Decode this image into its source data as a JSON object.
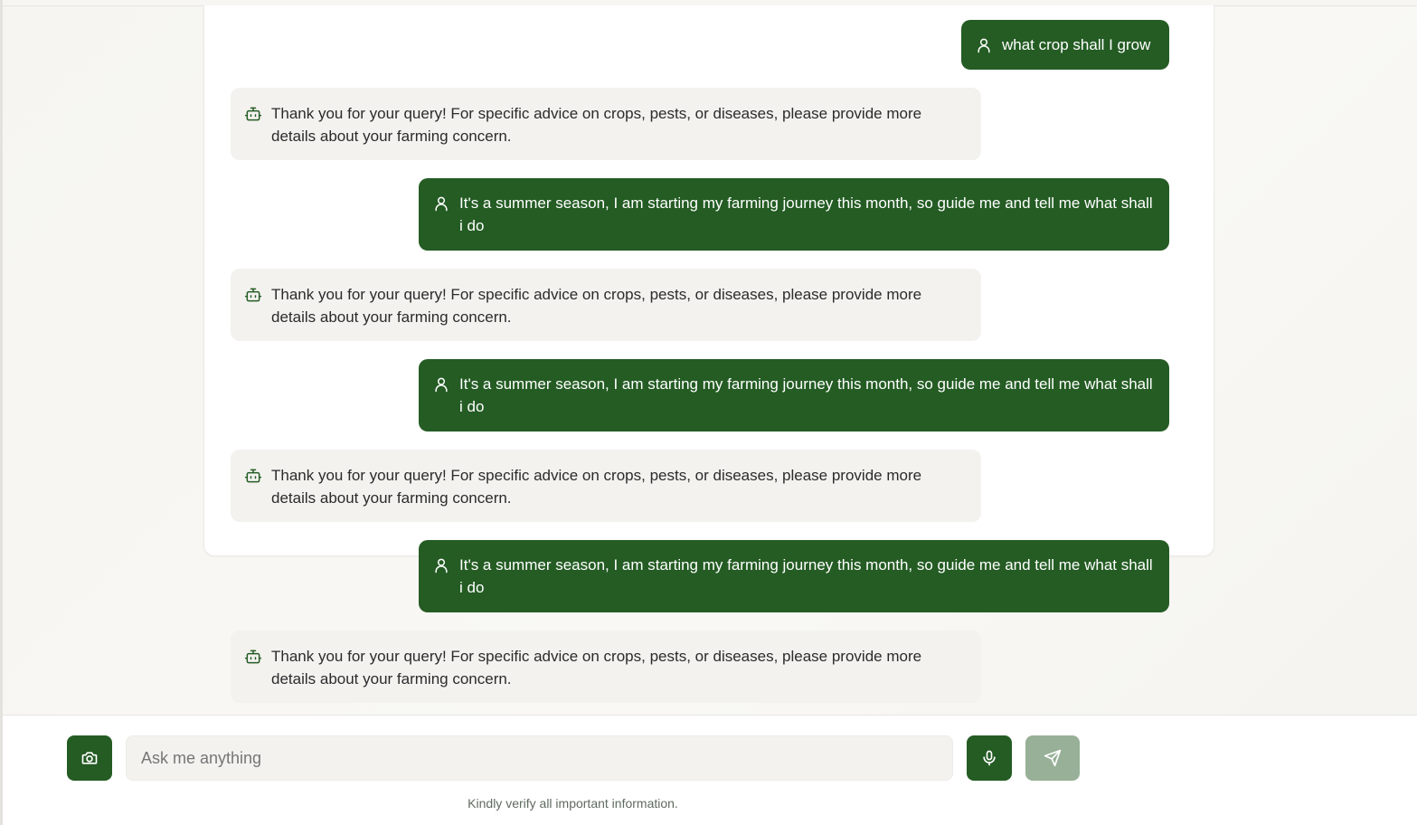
{
  "conversation": {
    "messages": [
      {
        "role": "user",
        "text": "what crop shall I grow"
      },
      {
        "role": "bot",
        "text": "Thank you for your query! For specific advice on crops, pests, or diseases, please provide more details about your farming concern."
      },
      {
        "role": "user",
        "text": "It's a summer season, I am starting my farming journey this month, so guide me and tell me what shall i do"
      },
      {
        "role": "bot",
        "text": "Thank you for your query! For specific advice on crops, pests, or diseases, please provide more details about your farming concern."
      },
      {
        "role": "user",
        "text": "It's a summer season, I am starting my farming journey this month, so guide me and tell me what shall i do"
      },
      {
        "role": "bot",
        "text": "Thank you for your query! For specific advice on crops, pests, or diseases, please provide more details about your farming concern."
      },
      {
        "role": "user",
        "text": "It's a summer season, I am starting my farming journey this month, so guide me and tell me what shall i do"
      },
      {
        "role": "bot",
        "text": "Thank you for your query! For specific advice on crops, pests, or diseases, please provide more details about your farming concern."
      }
    ],
    "icons": {
      "user": "user-icon",
      "bot": "bot-icon"
    }
  },
  "composer": {
    "input_placeholder": "Ask me anything",
    "input_value": "",
    "disclaimer": "Kindly verify all important information.",
    "icons": {
      "camera": "camera-icon",
      "mic": "microphone-icon",
      "send": "send-icon"
    }
  },
  "colors": {
    "primary": "#245c24",
    "send_disabled": "#97b097",
    "bot_bubble": "#f3f2ef",
    "page_bg": "#f8f7f4"
  }
}
